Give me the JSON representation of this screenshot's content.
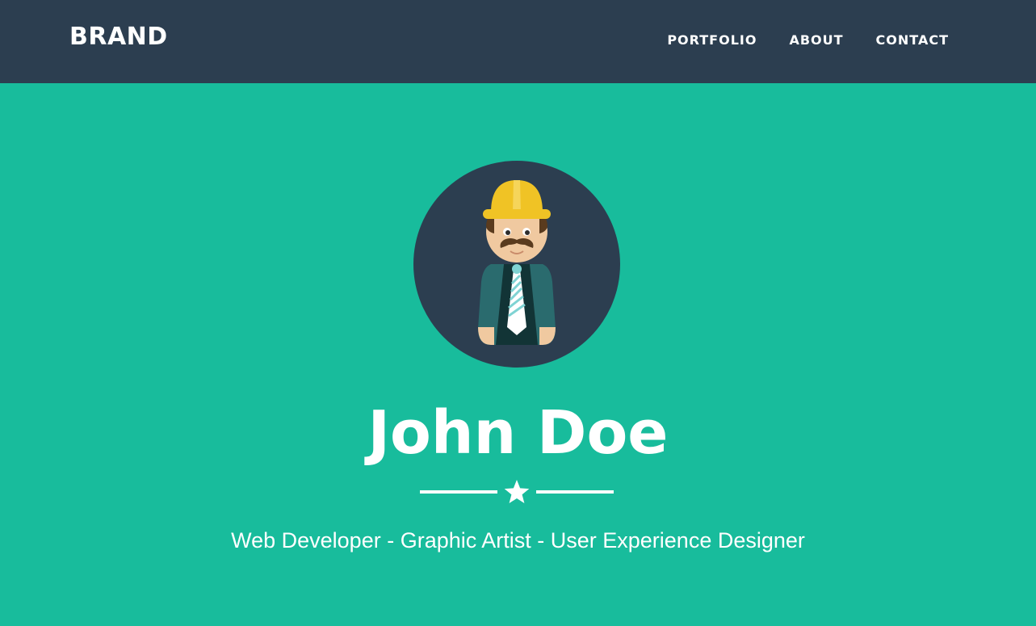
{
  "navbar": {
    "brand": "BRAND",
    "links": [
      {
        "label": "PORTFOLIO"
      },
      {
        "label": "ABOUT"
      },
      {
        "label": "CONTACT"
      }
    ]
  },
  "hero": {
    "avatar_icon": "construction-worker-avatar-icon",
    "name": "John Doe",
    "divider_icon": "star-icon",
    "tagline": "Web Developer - Graphic Artist - User Experience Designer"
  },
  "colors": {
    "navbar_bg": "#2c3e50",
    "hero_bg": "#18bc9c",
    "text": "#ffffff",
    "helmet": "#f0c325",
    "jacket": "#2a6b6e"
  }
}
